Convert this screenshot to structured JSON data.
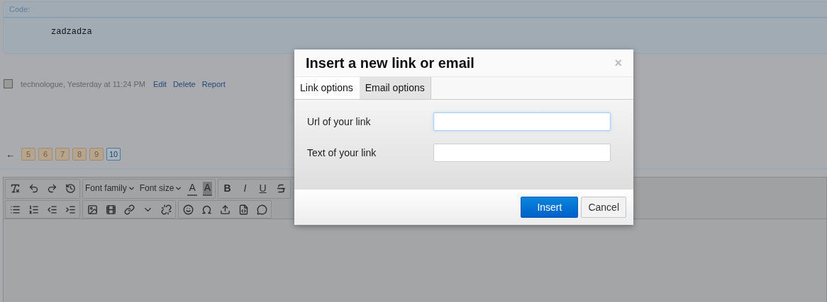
{
  "code_block": {
    "header": "Code:",
    "code": "zadzadza"
  },
  "post_meta": {
    "checked": false,
    "author_time": "technologue, Yesterday at 11:24 PM",
    "links": [
      "Edit",
      "Delete",
      "Report"
    ]
  },
  "pagination": {
    "prev": "←",
    "pages": [
      {
        "label": "5",
        "selected": false
      },
      {
        "label": "6",
        "selected": false
      },
      {
        "label": "7",
        "selected": false
      },
      {
        "label": "8",
        "selected": false
      },
      {
        "label": "9",
        "selected": false
      },
      {
        "label": "10",
        "selected": true
      }
    ]
  },
  "toolbar": {
    "dropdowns": [
      "Font family",
      "Font size"
    ],
    "color_buttons": [
      "A",
      "A"
    ],
    "style_buttons": [
      "B",
      "I",
      "U"
    ]
  },
  "dialog": {
    "title": "Insert a new link or email",
    "close": "×",
    "tabs": [
      {
        "label": "Link options",
        "selected": true
      },
      {
        "label": "Email options",
        "selected": false
      }
    ],
    "fields": [
      {
        "label": "Url of your link",
        "focused": true
      },
      {
        "label": "Text of your link",
        "focused": false
      }
    ],
    "buttons": [
      {
        "label": "Insert",
        "kind": "primary"
      },
      {
        "label": "Cancel",
        "kind": "secondary"
      }
    ]
  }
}
